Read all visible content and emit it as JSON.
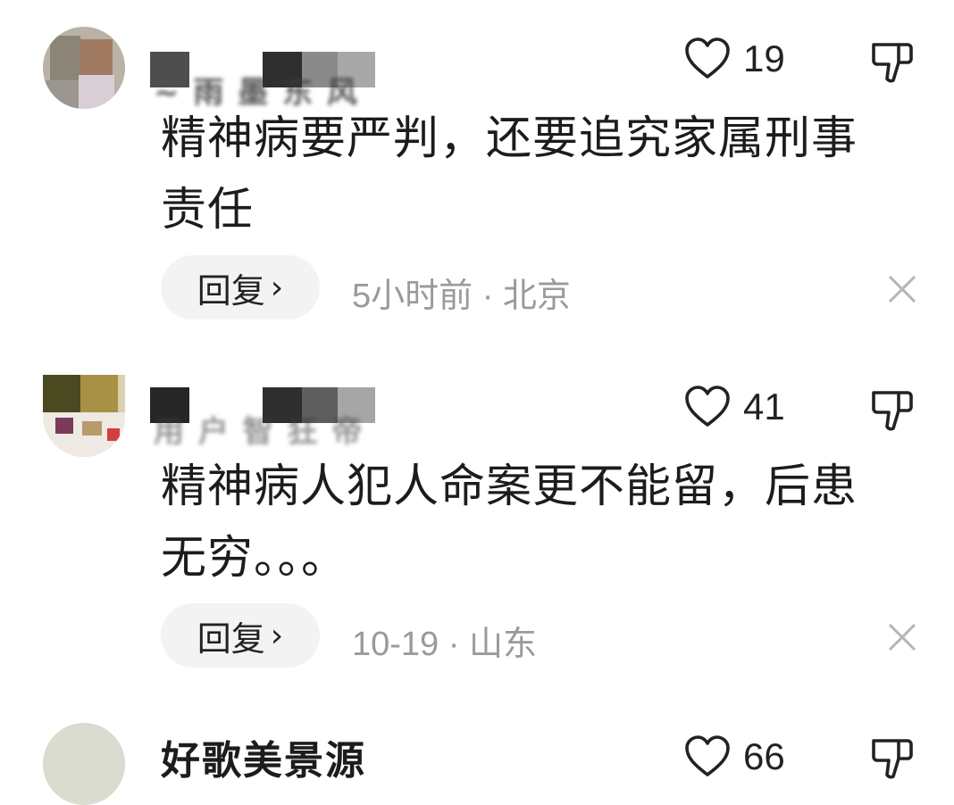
{
  "comments": [
    {
      "username": "~ 雨 墨 东 风",
      "likes": "19",
      "text": "精神病要严判，还要追究家属刑事责任",
      "reply_label": "回复",
      "chevron": "›",
      "time": "5小时前",
      "separator": " · ",
      "location": "北京"
    },
    {
      "username": "用 户 智 狂 帝",
      "likes": "41",
      "text": "精神病人犯人命案更不能留，后患无穷。。。",
      "reply_label": "回复",
      "chevron": "›",
      "time": "10-19",
      "separator": " · ",
      "location": "山东"
    },
    {
      "username": "好歌美景源",
      "likes": "66"
    }
  ],
  "icons": {
    "like": "heart-outline-icon",
    "dislike": "thumbs-down-icon",
    "close": "close-icon"
  },
  "colors": {
    "text": "#1c1c1c",
    "meta": "#9a9a9a",
    "pill": "#f3f3f3"
  }
}
